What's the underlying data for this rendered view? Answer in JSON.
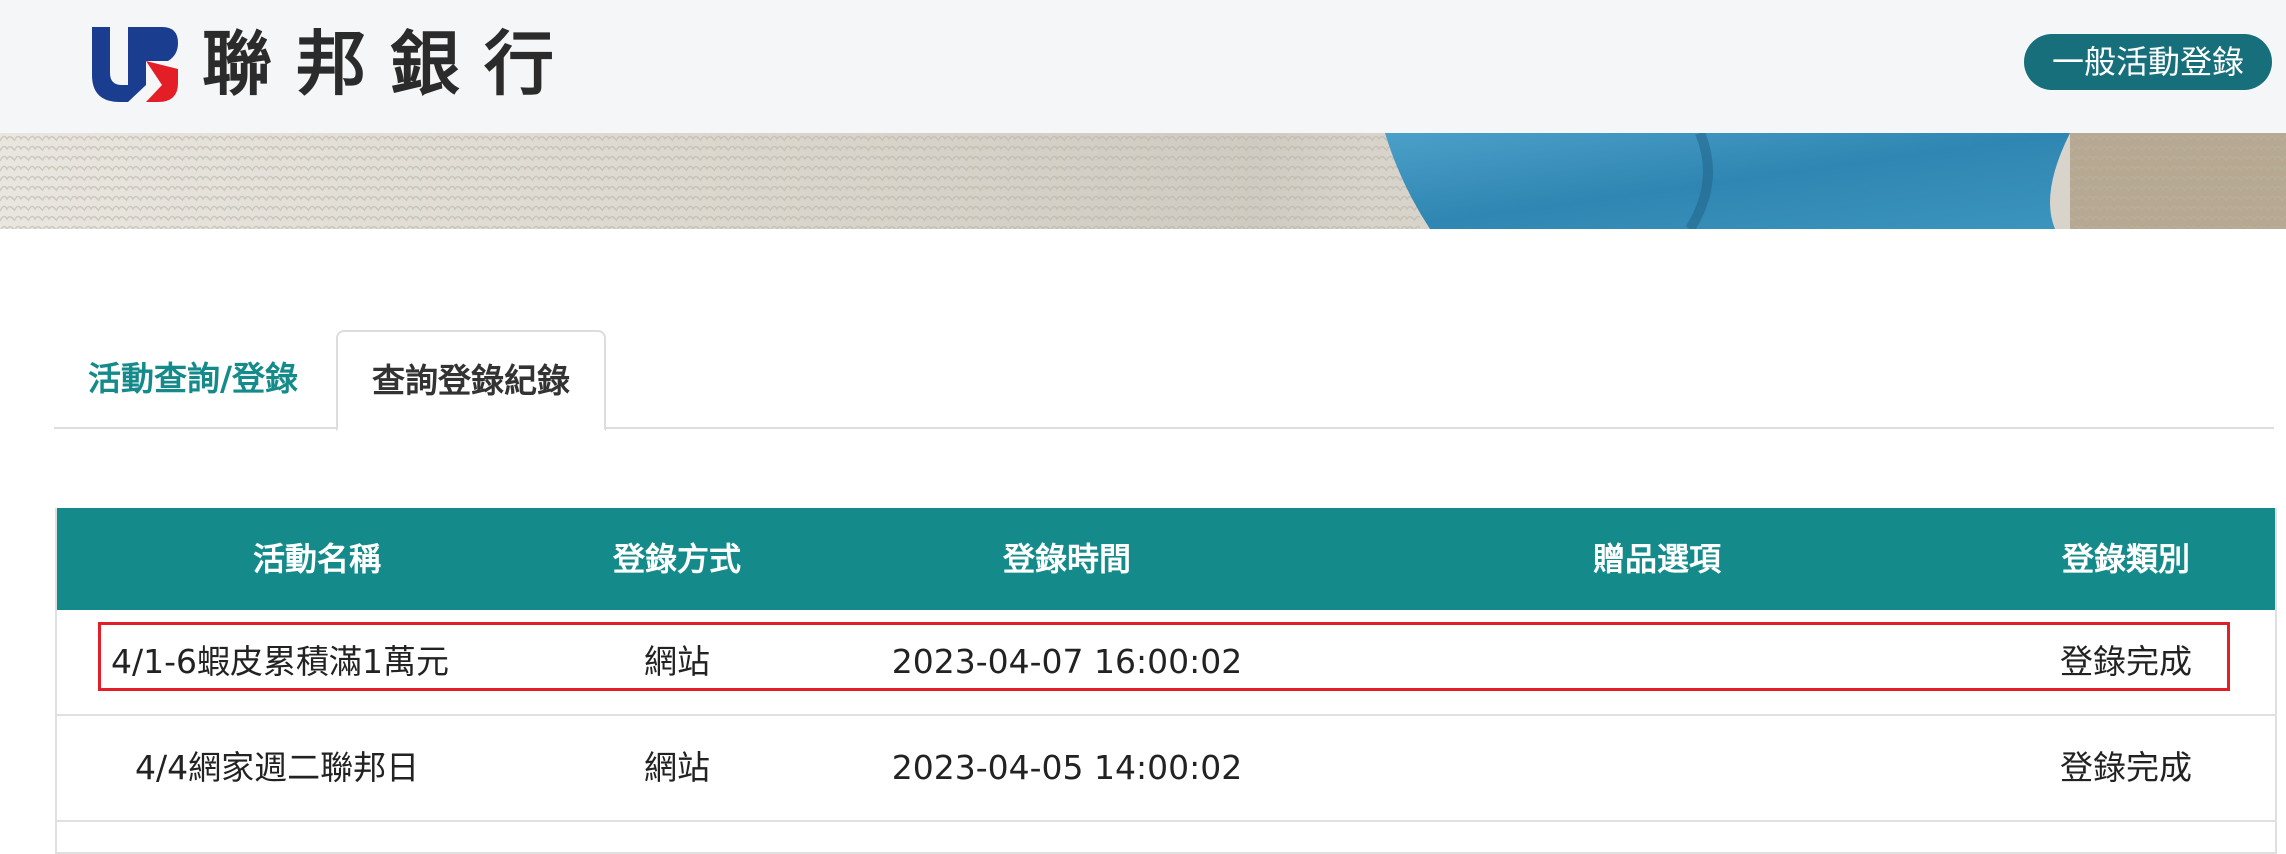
{
  "header": {
    "bank_name": "聯邦銀行",
    "top_button_label": "一般活動登錄",
    "accent_color": "#166f7a"
  },
  "tabs": [
    {
      "label": "活動查詢/登錄",
      "active": false
    },
    {
      "label": "查詢登錄紀錄",
      "active": true
    }
  ],
  "table": {
    "header_color": "#158a8a",
    "columns": [
      "活動名稱",
      "登錄方式",
      "登錄時間",
      "贈品選項",
      "登錄類別"
    ],
    "rows": [
      {
        "name": "4/1-6蝦皮累積滿1萬元",
        "method": "網站",
        "time": "2023-04-07 16:00:02",
        "gift": "",
        "type": "登錄完成",
        "highlighted": true
      },
      {
        "name": "4/4網家週二聯邦日",
        "method": "網站",
        "time": "2023-04-05 14:00:02",
        "gift": "",
        "type": "登錄完成",
        "highlighted": false
      }
    ]
  },
  "highlight_color": "#e41e26"
}
